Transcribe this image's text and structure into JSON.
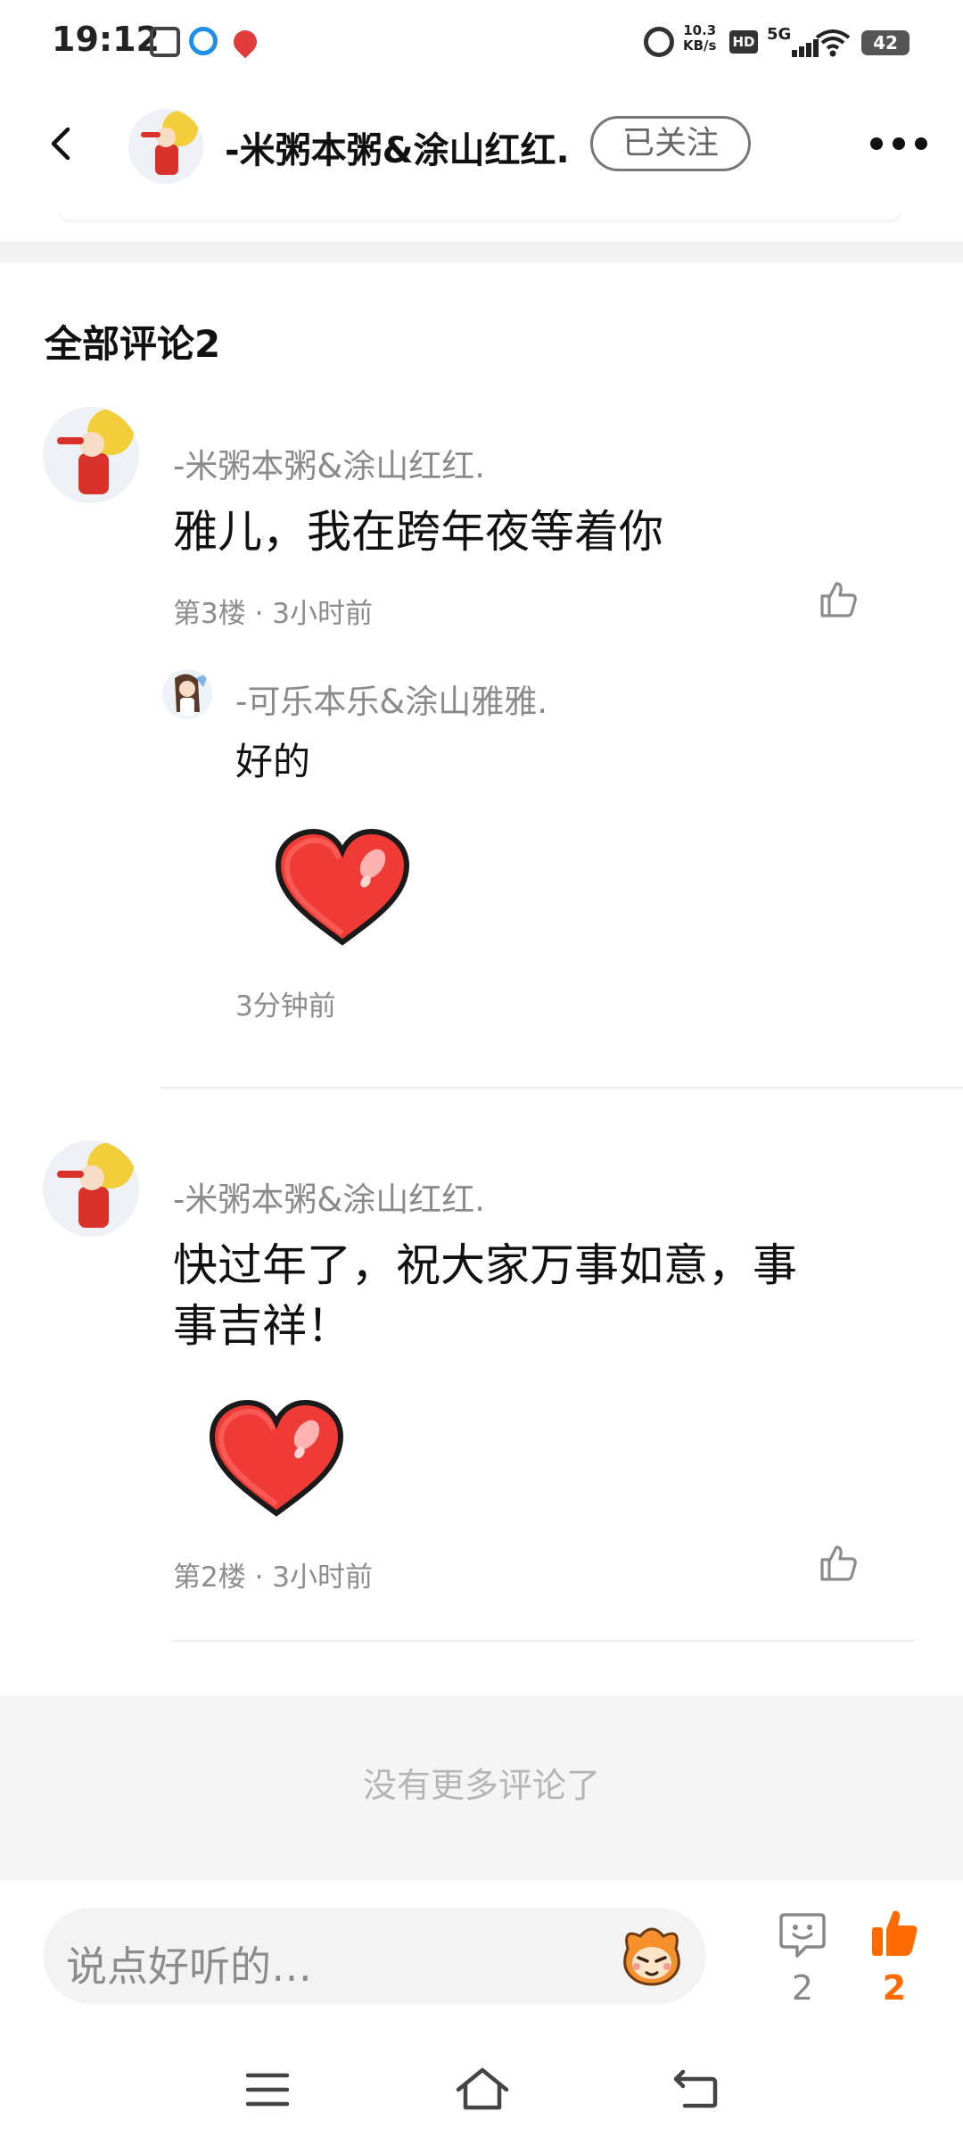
{
  "status_bar": {
    "time": "19:12",
    "net_speed_value": "10.3",
    "net_speed_unit": "KB/s",
    "hd_label": "HD",
    "network_label": "5G",
    "battery": "42",
    "icons": [
      "app-icon",
      "browser-icon",
      "map-pin-icon",
      "alarm-icon",
      "signal-icon",
      "wifi-icon",
      "battery-icon"
    ]
  },
  "header": {
    "author_name": "-米粥本粥&涂山红红.",
    "follow_label": "已关注"
  },
  "comments_section": {
    "title": "全部评论2",
    "comments": [
      {
        "username": "-米粥本粥&涂山红红.",
        "text": "雅儿，我在跨年夜等着你",
        "meta": "第3楼 · 3小时前",
        "reply": {
          "username": "-可乐本乐&涂山雅雅.",
          "text": "好的",
          "sticker": "heart-sticker",
          "time": "3分钟前"
        }
      },
      {
        "username": "-米粥本粥&涂山红红.",
        "text_line1": "快过年了，祝大家万事如意，事",
        "text_line2": "事吉祥！",
        "sticker": "heart-sticker",
        "meta": "第2楼 · 3小时前"
      }
    ],
    "no_more": "没有更多评论了"
  },
  "bottom_bar": {
    "input_placeholder": "说点好听的…",
    "comment_count": "2",
    "like_count": "2",
    "accent_color": "#ff6a00"
  }
}
